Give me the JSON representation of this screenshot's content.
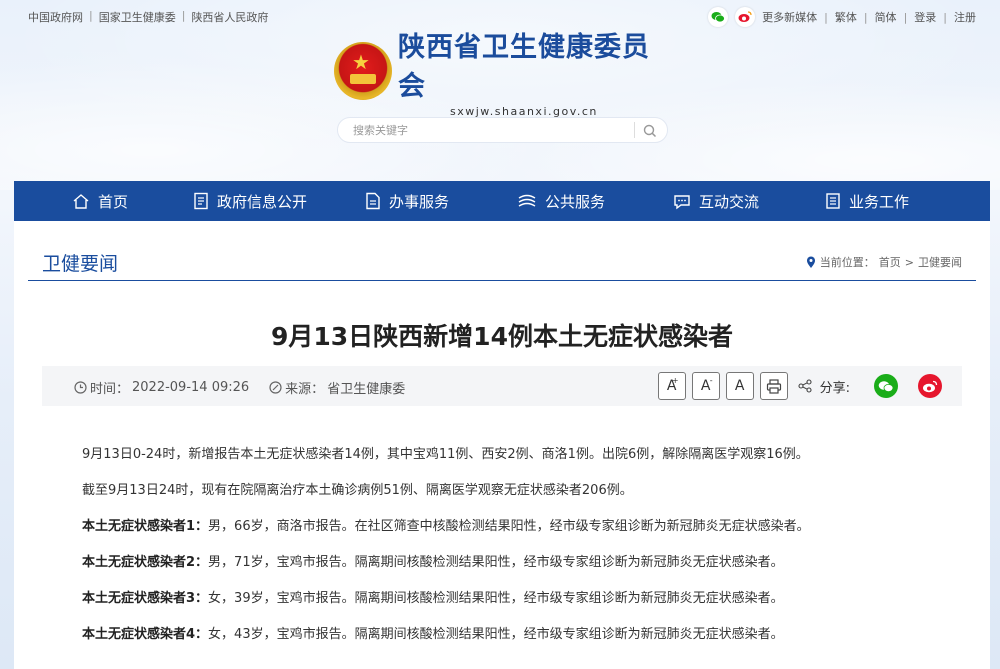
{
  "topbar": {
    "links": [
      "中国政府网",
      "国家卫生健康委",
      "陕西省人民政府"
    ],
    "more_media": "更多新媒体",
    "traditional": "繁体",
    "simplified": "简体",
    "login": "登录",
    "register": "注册"
  },
  "brand": {
    "title": "陕西省卫生健康委员会",
    "domain": "sxwjw.shaanxi.gov.cn"
  },
  "search": {
    "placeholder": "搜索关键字"
  },
  "nav": [
    {
      "label": "首页",
      "icon": "home-icon"
    },
    {
      "label": "政府信息公开",
      "icon": "document-icon"
    },
    {
      "label": "办事服务",
      "icon": "file-icon"
    },
    {
      "label": "公共服务",
      "icon": "service-icon"
    },
    {
      "label": "互动交流",
      "icon": "chat-icon"
    },
    {
      "label": "业务工作",
      "icon": "task-icon"
    }
  ],
  "section": {
    "title": "卫健要闻",
    "location_label": "当前位置：",
    "crumb_home": "首页",
    "crumb_sep": ">",
    "crumb_current": "卫健要闻"
  },
  "article": {
    "title": "9月13日陕西新增14例本土无症状感染者",
    "time_label": "时间：",
    "time": "2022-09-14 09:26",
    "source_label": "来源：",
    "source": "省卫生健康委",
    "font_large": "A",
    "font_medium": "A",
    "font_small": "A",
    "share_label": "分享:",
    "paragraphs": [
      {
        "lead": "",
        "text": "9月13日0-24时，新增报告本土无症状感染者14例，其中宝鸡11例、西安2例、商洛1例。出院6例，解除隔离医学观察16例。"
      },
      {
        "lead": "",
        "text": "截至9月13日24时，现有在院隔离治疗本土确诊病例51例、隔离医学观察无症状感染者206例。"
      },
      {
        "lead": "本土无症状感染者1：",
        "text": "男，66岁，商洛市报告。在社区筛查中核酸检测结果阳性，经市级专家组诊断为新冠肺炎无症状感染者。"
      },
      {
        "lead": "本土无症状感染者2：",
        "text": "男，71岁，宝鸡市报告。隔离期间核酸检测结果阳性，经市级专家组诊断为新冠肺炎无症状感染者。"
      },
      {
        "lead": "本土无症状感染者3：",
        "text": "女，39岁，宝鸡市报告。隔离期间核酸检测结果阳性，经市级专家组诊断为新冠肺炎无症状感染者。"
      },
      {
        "lead": "本土无症状感染者4：",
        "text": "女，43岁，宝鸡市报告。隔离期间核酸检测结果阳性，经市级专家组诊断为新冠肺炎无症状感染者。"
      }
    ]
  },
  "colors": {
    "nav_bg": "#1a4d9e",
    "brand_blue": "#1b4c9c",
    "wechat_green": "#1aad19",
    "weibo_red": "#e6162d"
  }
}
